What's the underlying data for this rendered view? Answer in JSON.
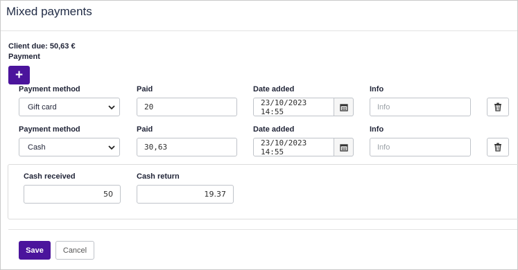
{
  "modal": {
    "title": "Mixed payments"
  },
  "client_due": "Client due: 50,63 €",
  "payment_label": "Payment",
  "add_button": {
    "label": "+"
  },
  "rows": [
    {
      "labels": {
        "method": "Payment method",
        "paid": "Paid",
        "date": "Date added",
        "info": "Info"
      },
      "method": "Gift card",
      "paid": "20",
      "date": "23/10/2023 14:55",
      "info_placeholder": "Info"
    },
    {
      "labels": {
        "method": "Payment method",
        "paid": "Paid",
        "date": "Date added",
        "info": "Info"
      },
      "method": "Cash",
      "paid": "30,63",
      "date": "23/10/2023 14:55",
      "info_placeholder": "Info"
    }
  ],
  "cash": {
    "received_label": "Cash received",
    "received_value": "50",
    "return_label": "Cash return",
    "return_value": "19.37"
  },
  "footer": {
    "save_label": "Save",
    "cancel_label": "Cancel"
  },
  "colors": {
    "primary": "#4b149c"
  },
  "icons": {
    "add": "plus-icon",
    "calendar": "calendar-icon",
    "delete": "trash-icon",
    "select": "chevron-down-icon"
  }
}
